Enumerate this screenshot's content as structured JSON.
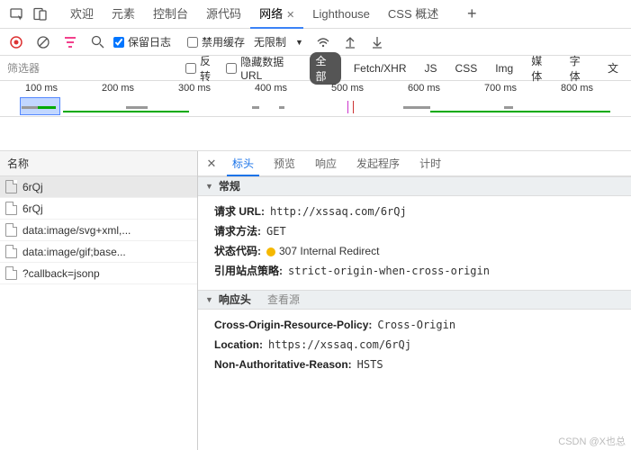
{
  "tabs": {
    "items": [
      "欢迎",
      "元素",
      "控制台",
      "源代码",
      "网络",
      "Lighthouse",
      "CSS 概述"
    ],
    "active": 4
  },
  "toolbar": {
    "preserve_log": "保留日志",
    "disable_cache": "禁用缓存",
    "throttle": "无限制"
  },
  "filter": {
    "placeholder": "筛选器",
    "invert": "反转",
    "hide_data": "隐藏数据 URL",
    "types": [
      "全部",
      "Fetch/XHR",
      "JS",
      "CSS",
      "Img",
      "媒体",
      "字体",
      "文"
    ],
    "active": 0
  },
  "timeline": {
    "ticks": [
      "100 ms",
      "200 ms",
      "300 ms",
      "400 ms",
      "500 ms",
      "600 ms",
      "700 ms",
      "800 ms"
    ]
  },
  "namecol": {
    "header": "名称",
    "rows": [
      "6rQj",
      "6rQj",
      "data:image/svg+xml,...",
      "data:image/gif;base...",
      "?callback=jsonp"
    ],
    "selected": 0
  },
  "detail": {
    "tabs": [
      "标头",
      "预览",
      "响应",
      "发起程序",
      "计时"
    ],
    "active": 0,
    "general": {
      "title": "常规",
      "url_k": "请求 URL:",
      "url_v": "http://xssaq.com/6rQj",
      "method_k": "请求方法:",
      "method_v": "GET",
      "status_k": "状态代码:",
      "status_v": "307 Internal Redirect",
      "ref_k": "引用站点策略:",
      "ref_v": "strict-origin-when-cross-origin"
    },
    "response": {
      "title": "响应头",
      "view_source": "查看源",
      "h1_k": "Cross-Origin-Resource-Policy:",
      "h1_v": "Cross-Origin",
      "h2_k": "Location:",
      "h2_v": "https://xssaq.com/6rQj",
      "h3_k": "Non-Authoritative-Reason:",
      "h3_v": "HSTS"
    }
  },
  "watermark": "CSDN @X也总"
}
